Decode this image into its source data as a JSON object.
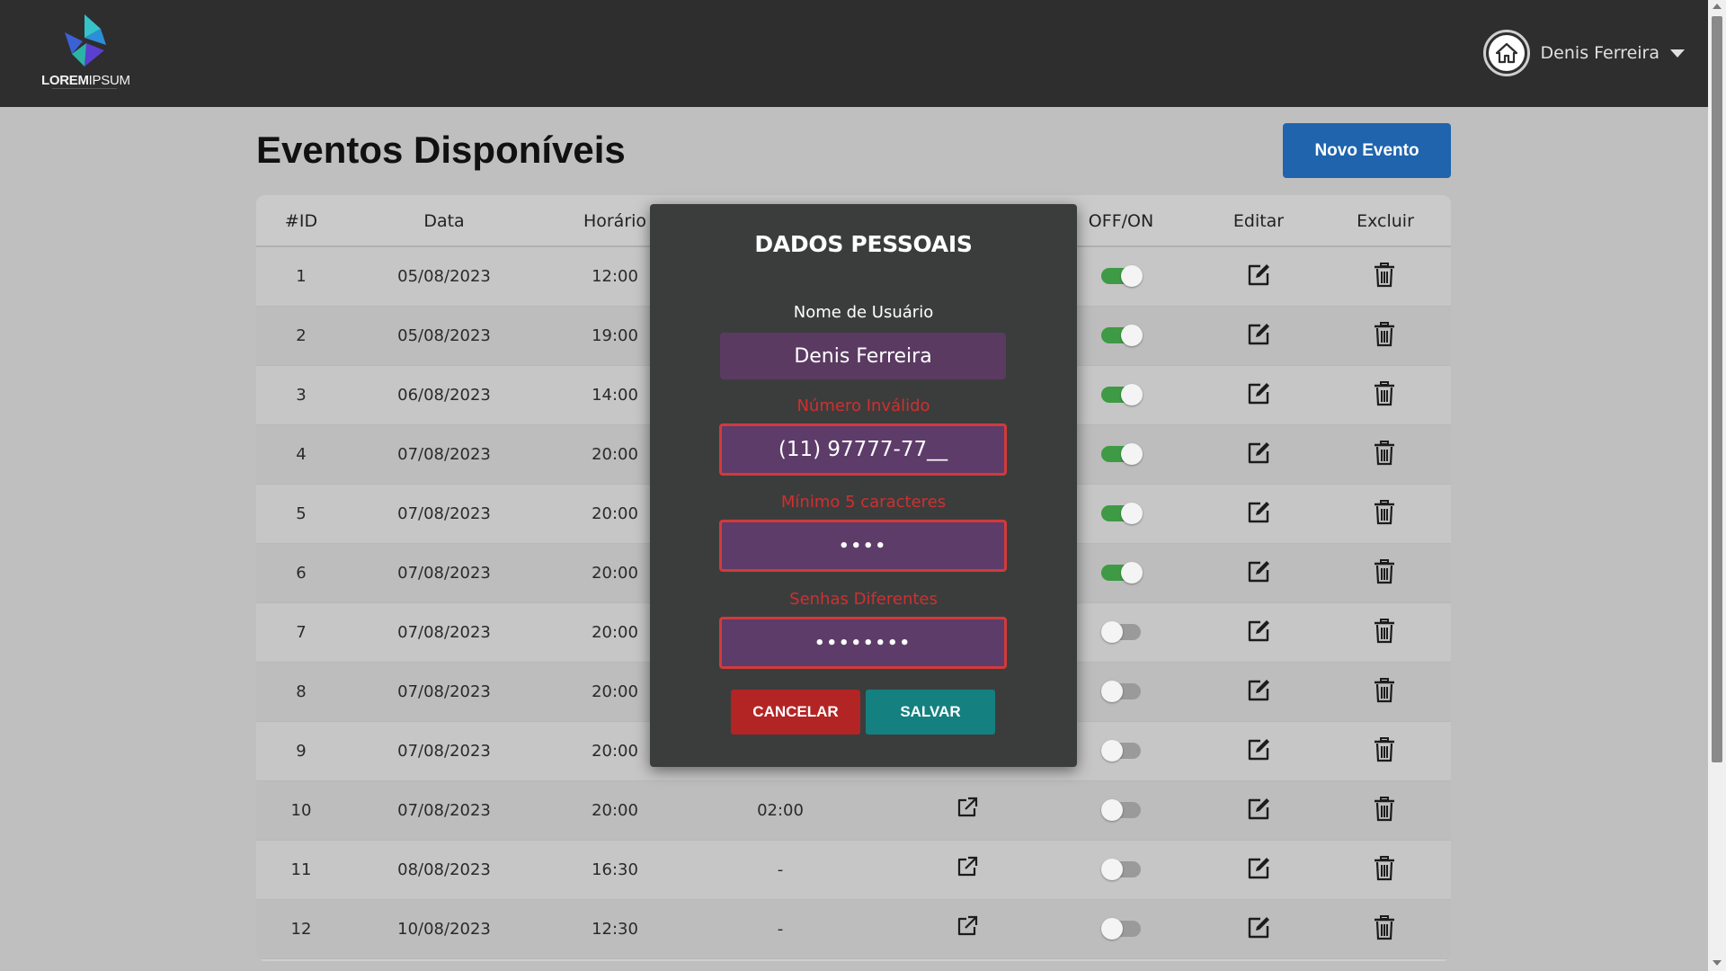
{
  "header": {
    "logo_text_bold": "LOREM",
    "logo_text_light": "IPSUM",
    "user_name": "Denis Ferreira",
    "home_icon": "home-icon",
    "caret_icon": "caret-down-icon"
  },
  "page": {
    "title": "Eventos Disponíveis",
    "new_event_label": "Novo Evento"
  },
  "table": {
    "columns": [
      "#ID",
      "Data",
      "Horário",
      "",
      "",
      "OFF/ON",
      "Editar",
      "Excluir"
    ],
    "rows": [
      {
        "id": "1",
        "data": "05/08/2023",
        "horario": "12:00",
        "duracao": "",
        "on": true
      },
      {
        "id": "2",
        "data": "05/08/2023",
        "horario": "19:00",
        "duracao": "",
        "on": true
      },
      {
        "id": "3",
        "data": "06/08/2023",
        "horario": "14:00",
        "duracao": "",
        "on": true
      },
      {
        "id": "4",
        "data": "07/08/2023",
        "horario": "20:00",
        "duracao": "",
        "on": true
      },
      {
        "id": "5",
        "data": "07/08/2023",
        "horario": "20:00",
        "duracao": "",
        "on": true
      },
      {
        "id": "6",
        "data": "07/08/2023",
        "horario": "20:00",
        "duracao": "",
        "on": true
      },
      {
        "id": "7",
        "data": "07/08/2023",
        "horario": "20:00",
        "duracao": "",
        "on": false
      },
      {
        "id": "8",
        "data": "07/08/2023",
        "horario": "20:00",
        "duracao": "",
        "on": false
      },
      {
        "id": "9",
        "data": "07/08/2023",
        "horario": "20:00",
        "duracao": "",
        "on": false
      },
      {
        "id": "10",
        "data": "07/08/2023",
        "horario": "20:00",
        "duracao": "02:00",
        "on": false
      },
      {
        "id": "11",
        "data": "08/08/2023",
        "horario": "16:30",
        "duracao": "-",
        "on": false
      },
      {
        "id": "12",
        "data": "10/08/2023",
        "horario": "12:30",
        "duracao": "-",
        "on": false
      }
    ]
  },
  "modal": {
    "title": "DADOS PESSOAIS",
    "username_label": "Nome de Usuário",
    "username_value": "Denis Ferreira",
    "phone_error": "Número Inválido",
    "phone_value": "(11) 97777-77__",
    "password_error": "Mínimo 5 caracteres",
    "password_value": "••••",
    "confirm_error": "Senhas Diferentes",
    "confirm_value": "••••••••",
    "cancel_label": "CANCELAR",
    "save_label": "SALVAR"
  },
  "colors": {
    "topbar": "#2e2e2e",
    "primary_button": "#1f64ad",
    "toggle_on": "#3e9a45",
    "error": "#d12f2f",
    "field_bg": "#5b3a62",
    "cancel": "#b32424",
    "save": "#158080"
  }
}
